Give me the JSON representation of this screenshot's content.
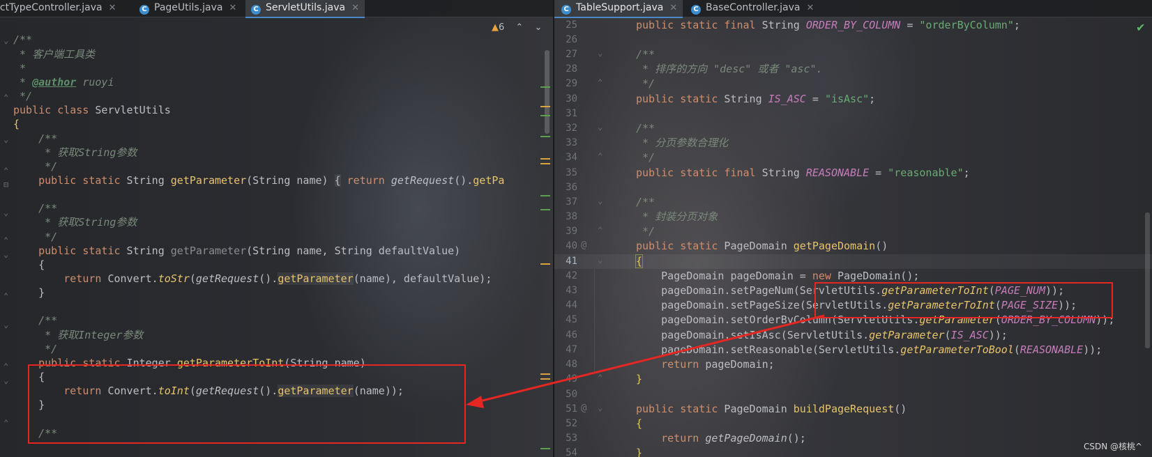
{
  "left_tabs": [
    {
      "label": "ictTypeController.java",
      "has_icon": false,
      "active": false
    },
    {
      "label": "PageUtils.java",
      "has_icon": true,
      "active": false
    },
    {
      "label": "ServletUtils.java",
      "has_icon": true,
      "active": true
    }
  ],
  "right_tabs": [
    {
      "label": "TableSupport.java",
      "active": true
    },
    {
      "label": "BaseController.java",
      "active": false
    }
  ],
  "inspection": {
    "warning_count": "6",
    "up": "⌃",
    "down": "⌄"
  },
  "left_code": [
    "/**",
    " * 客户端工具类",
    " *",
    " * @author ruoyi",
    " */",
    "public class ServletUtils",
    "{",
    "    /**",
    "     * 获取String参数",
    "     */",
    "    public static String getParameter(String name) { return getRequest().getPa",
    "",
    "    /**",
    "     * 获取String参数",
    "     */",
    "    public static String getParameter(String name, String defaultValue)",
    "    {",
    "        return Convert.toStr(getRequest().getParameter(name), defaultValue);",
    "    }",
    "",
    "    /**",
    "     * 获取Integer参数",
    "     */",
    "    public static Integer getParameterToInt(String name)",
    "    {",
    "        return Convert.toInt(getRequest().getParameter(name));",
    "    }",
    "",
    "    /**"
  ],
  "right_code": [
    {
      "n": "25",
      "t": "    public static final String ORDER_BY_COLUMN = \"orderByColumn\";"
    },
    {
      "n": "26",
      "t": ""
    },
    {
      "n": "27",
      "t": "    /**"
    },
    {
      "n": "28",
      "t": "     * 排序的方向 \"desc\" 或者 \"asc\"."
    },
    {
      "n": "29",
      "t": "     */"
    },
    {
      "n": "30",
      "t": "    public static String IS_ASC = \"isAsc\";"
    },
    {
      "n": "31",
      "t": ""
    },
    {
      "n": "32",
      "t": "    /**"
    },
    {
      "n": "33",
      "t": "     * 分页参数合理化"
    },
    {
      "n": "34",
      "t": "     */"
    },
    {
      "n": "35",
      "t": "    public static final String REASONABLE = \"reasonable\";"
    },
    {
      "n": "36",
      "t": ""
    },
    {
      "n": "37",
      "t": "    /**"
    },
    {
      "n": "38",
      "t": "     * 封装分页对象"
    },
    {
      "n": "39",
      "t": "     */"
    },
    {
      "n": "40",
      "t": "    public static PageDomain getPageDomain()"
    },
    {
      "n": "41",
      "t": "    {"
    },
    {
      "n": "42",
      "t": "        PageDomain pageDomain = new PageDomain();"
    },
    {
      "n": "43",
      "t": "        pageDomain.setPageNum(ServletUtils.getParameterToInt(PAGE_NUM));"
    },
    {
      "n": "44",
      "t": "        pageDomain.setPageSize(ServletUtils.getParameterToInt(PAGE_SIZE));"
    },
    {
      "n": "45",
      "t": "        pageDomain.setOrderByColumn(ServletUtils.getParameter(ORDER_BY_COLUMN));"
    },
    {
      "n": "46",
      "t": "        pageDomain.setIsAsc(ServletUtils.getParameter(IS_ASC));"
    },
    {
      "n": "47",
      "t": "        pageDomain.setReasonable(ServletUtils.getParameterToBool(REASONABLE));"
    },
    {
      "n": "48",
      "t": "        return pageDomain;"
    },
    {
      "n": "49",
      "t": "    }"
    },
    {
      "n": "50",
      "t": ""
    },
    {
      "n": "51",
      "t": "    public static PageDomain buildPageRequest()"
    },
    {
      "n": "52",
      "t": "    {"
    },
    {
      "n": "53",
      "t": "        return getPageDomain();"
    },
    {
      "n": "54",
      "t": "    }"
    }
  ],
  "watermark": "CSDN @核桃^",
  "colors": {
    "keyword": "#cf8e6d",
    "method": "#56a8f5",
    "string": "#6aab73",
    "constant": "#c77dbb",
    "comment": "#7a8a7a",
    "annotation_box": "#e52623"
  }
}
